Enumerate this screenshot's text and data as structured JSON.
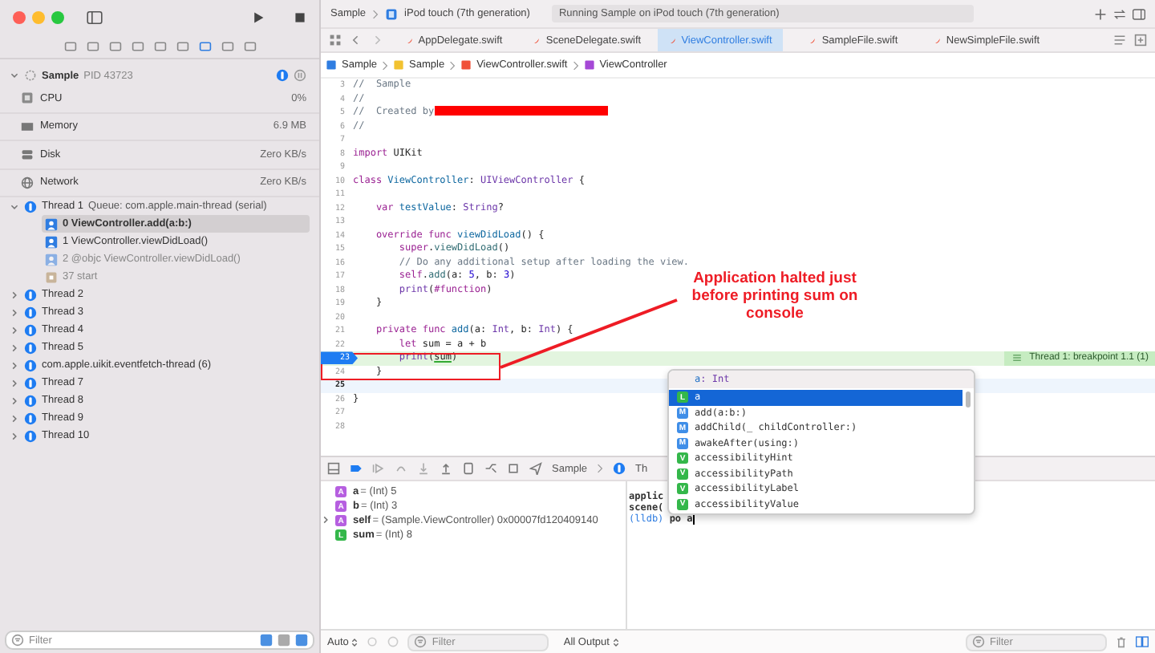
{
  "sidebar": {
    "process": {
      "name": "Sample",
      "pid": "PID 43723",
      "expanded": true
    },
    "gauges": [
      {
        "kind": "cpu",
        "label": "CPU",
        "value": "0%"
      },
      {
        "kind": "memory",
        "label": "Memory",
        "value": "6.9 MB"
      },
      {
        "kind": "disk",
        "label": "Disk",
        "value": "Zero KB/s"
      },
      {
        "kind": "network",
        "label": "Network",
        "value": "Zero KB/s"
      }
    ],
    "threads": [
      {
        "label": "Thread 1",
        "detail": "Queue: com.apple.main-thread (serial)",
        "expanded": true,
        "frames": [
          {
            "kind": "user",
            "label": "0 ViewController.add(a:b:)",
            "selected": true
          },
          {
            "kind": "user",
            "label": "1 ViewController.viewDidLoad()",
            "selected": false
          },
          {
            "kind": "dimmed",
            "label": "2 @objc ViewController.viewDidLoad()",
            "selected": false
          },
          {
            "kind": "system",
            "label": "37 start",
            "selected": false
          }
        ]
      },
      {
        "label": "Thread 2",
        "expanded": false
      },
      {
        "label": "Thread 3",
        "expanded": false
      },
      {
        "label": "Thread 4",
        "expanded": false
      },
      {
        "label": "Thread 5",
        "expanded": false
      },
      {
        "label": "com.apple.uikit.eventfetch-thread (6)",
        "expanded": false
      },
      {
        "label": "Thread 7",
        "expanded": false
      },
      {
        "label": "Thread 8",
        "expanded": false
      },
      {
        "label": "Thread 9",
        "expanded": false
      },
      {
        "label": "Thread 10",
        "expanded": false
      }
    ],
    "filter_placeholder": "Filter"
  },
  "toolbar": {
    "scheme": "Sample",
    "device": "iPod touch (7th generation)",
    "status": "Running Sample on iPod touch (7th generation)"
  },
  "tabs": [
    {
      "label": "AppDelegate.swift",
      "selected": false
    },
    {
      "label": "SceneDelegate.swift",
      "selected": false
    },
    {
      "label": "ViewController.swift",
      "selected": true
    },
    {
      "label": "SampleFile.swift",
      "selected": false
    },
    {
      "label": "NewSimpleFile.swift",
      "selected": false
    }
  ],
  "breadcrumb": [
    {
      "kind": "project",
      "label": "Sample"
    },
    {
      "kind": "folder",
      "label": "Sample"
    },
    {
      "kind": "swift",
      "label": "ViewController.swift"
    },
    {
      "kind": "class",
      "label": "ViewController"
    }
  ],
  "editor": {
    "lines": [
      {
        "number": "3",
        "kind": "plain",
        "segments": [
          {
            "kind": "comment",
            "text": "//  Sample"
          }
        ]
      },
      {
        "number": "4",
        "kind": "plain",
        "segments": [
          {
            "kind": "comment",
            "text": "//"
          }
        ]
      },
      {
        "number": "5",
        "kind": "plain",
        "segments": [
          {
            "kind": "comment",
            "text": "//  Created by"
          },
          {
            "kind": "redacted"
          }
        ]
      },
      {
        "number": "6",
        "kind": "plain",
        "segments": [
          {
            "kind": "comment",
            "text": "//"
          }
        ]
      },
      {
        "number": "7",
        "kind": "plain"
      },
      {
        "number": "8",
        "kind": "plain",
        "segments": [
          {
            "kind": "keyword",
            "text": "import"
          },
          {
            "kind": "plain",
            "text": " UIKit"
          }
        ]
      },
      {
        "number": "9",
        "kind": "plain"
      },
      {
        "number": "10",
        "kind": "plain",
        "segments": [
          {
            "kind": "keyword",
            "text": "class"
          },
          {
            "kind": "decl",
            "text": " ViewController"
          },
          {
            "kind": "plain",
            "text": ": "
          },
          {
            "kind": "type",
            "text": "UIViewController"
          },
          {
            "kind": "plain",
            "text": " {"
          }
        ]
      },
      {
        "number": "11",
        "kind": "plain"
      },
      {
        "number": "12",
        "kind": "plain",
        "segments": [
          {
            "kind": "keyword",
            "text": "    var"
          },
          {
            "kind": "decl",
            "text": " testValue"
          },
          {
            "kind": "plain",
            "text": ": "
          },
          {
            "kind": "type",
            "text": "String"
          },
          {
            "kind": "plain",
            "text": "?"
          }
        ]
      },
      {
        "number": "13",
        "kind": "plain"
      },
      {
        "number": "14",
        "kind": "plain",
        "segments": [
          {
            "kind": "keyword",
            "text": "    override func"
          },
          {
            "kind": "decl",
            "text": " viewDidLoad"
          },
          {
            "kind": "plain",
            "text": "() {"
          }
        ]
      },
      {
        "number": "15",
        "kind": "plain",
        "segments": [
          {
            "kind": "keyword",
            "text": "        super"
          },
          {
            "kind": "plain",
            "text": "."
          },
          {
            "kind": "call",
            "text": "viewDidLoad"
          },
          {
            "kind": "plain",
            "text": "()"
          }
        ]
      },
      {
        "number": "16",
        "kind": "plain",
        "segments": [
          {
            "kind": "comment",
            "text": "        // Do any additional setup after loading the view."
          }
        ]
      },
      {
        "number": "17",
        "kind": "plain",
        "segments": [
          {
            "kind": "keyword",
            "text": "        self"
          },
          {
            "kind": "plain",
            "text": "."
          },
          {
            "kind": "call",
            "text": "add"
          },
          {
            "kind": "plain",
            "text": "(a: "
          },
          {
            "kind": "number",
            "text": "5"
          },
          {
            "kind": "plain",
            "text": ", b: "
          },
          {
            "kind": "number",
            "text": "3"
          },
          {
            "kind": "plain",
            "text": ")"
          }
        ]
      },
      {
        "number": "18",
        "kind": "plain",
        "segments": [
          {
            "kind": "type",
            "text": "        print"
          },
          {
            "kind": "plain",
            "text": "("
          },
          {
            "kind": "keyword",
            "text": "#function"
          },
          {
            "kind": "plain",
            "text": ")"
          }
        ]
      },
      {
        "number": "19",
        "kind": "plain",
        "segments": [
          {
            "kind": "plain",
            "text": "    }"
          }
        ]
      },
      {
        "number": "20",
        "kind": "plain"
      },
      {
        "number": "21",
        "kind": "plain",
        "segments": [
          {
            "kind": "keyword",
            "text": "    private func"
          },
          {
            "kind": "decl",
            "text": " add"
          },
          {
            "kind": "plain",
            "text": "(a: "
          },
          {
            "kind": "type",
            "text": "Int"
          },
          {
            "kind": "plain",
            "text": ", b: "
          },
          {
            "kind": "type",
            "text": "Int"
          },
          {
            "kind": "plain",
            "text": ") {"
          }
        ]
      },
      {
        "number": "22",
        "kind": "plain",
        "segments": [
          {
            "kind": "keyword",
            "text": "        let"
          },
          {
            "kind": "plain",
            "text": " sum = a + b"
          }
        ]
      },
      {
        "number": "23",
        "kind": "paused",
        "segments": [
          {
            "kind": "type",
            "text": "        print"
          },
          {
            "kind": "plain",
            "text": "("
          },
          {
            "kind": "underlined",
            "text": "sum"
          },
          {
            "kind": "plain",
            "text": ")"
          }
        ]
      },
      {
        "number": "24",
        "kind": "plain",
        "segments": [
          {
            "kind": "plain",
            "text": "    }"
          }
        ]
      },
      {
        "number": "25",
        "kind": "cursor"
      },
      {
        "number": "26",
        "kind": "plain",
        "segments": [
          {
            "kind": "plain",
            "text": "}"
          }
        ]
      },
      {
        "number": "27",
        "kind": "plain"
      },
      {
        "number": "28",
        "kind": "plain"
      }
    ],
    "paused_badge": "Thread 1: breakpoint 1.1 (1)"
  },
  "annotation": {
    "text": "Application halted just before printing sum on console"
  },
  "completion": {
    "header_name": "a",
    "header_type": ": Int",
    "items": [
      {
        "kind": "local",
        "badge": "L",
        "text": "a",
        "selected": true
      },
      {
        "kind": "method",
        "badge": "M",
        "text": "add(a:b:)",
        "selected": false
      },
      {
        "kind": "method",
        "badge": "M",
        "text": "addChild(_ childController:)",
        "selected": false
      },
      {
        "kind": "method",
        "badge": "M",
        "text": "awakeAfter(using:)",
        "selected": false
      },
      {
        "kind": "var",
        "badge": "V",
        "text": "accessibilityHint",
        "selected": false
      },
      {
        "kind": "var",
        "badge": "V",
        "text": "accessibilityPath",
        "selected": false
      },
      {
        "kind": "var",
        "badge": "V",
        "text": "accessibilityLabel",
        "selected": false
      },
      {
        "kind": "var",
        "badge": "V",
        "text": "accessibilityValue",
        "selected": false
      }
    ]
  },
  "debug_bar": {
    "scheme": "Sample",
    "thread": "Th"
  },
  "variables": [
    {
      "kind": "argument",
      "badge": "A",
      "name": "a",
      "info": "= (Int) 5",
      "expandable": false
    },
    {
      "kind": "argument",
      "badge": "A",
      "name": "b",
      "info": "= (Int) 3",
      "expandable": false
    },
    {
      "kind": "argument",
      "badge": "A",
      "name": "self",
      "info": "= (Sample.ViewController) 0x00007fd120409140",
      "expandable": true
    },
    {
      "kind": "local",
      "badge": "L",
      "name": "sum",
      "info": "= (Int) 8",
      "expandable": false
    }
  ],
  "console": {
    "lines": [
      "applic",
      "scene("
    ],
    "prompt": "(lldb)",
    "command": "po a"
  },
  "bottom_bar": {
    "variables_mode": "Auto",
    "variables_filter": "Filter",
    "output_mode": "All Output",
    "output_filter": "Filter"
  }
}
